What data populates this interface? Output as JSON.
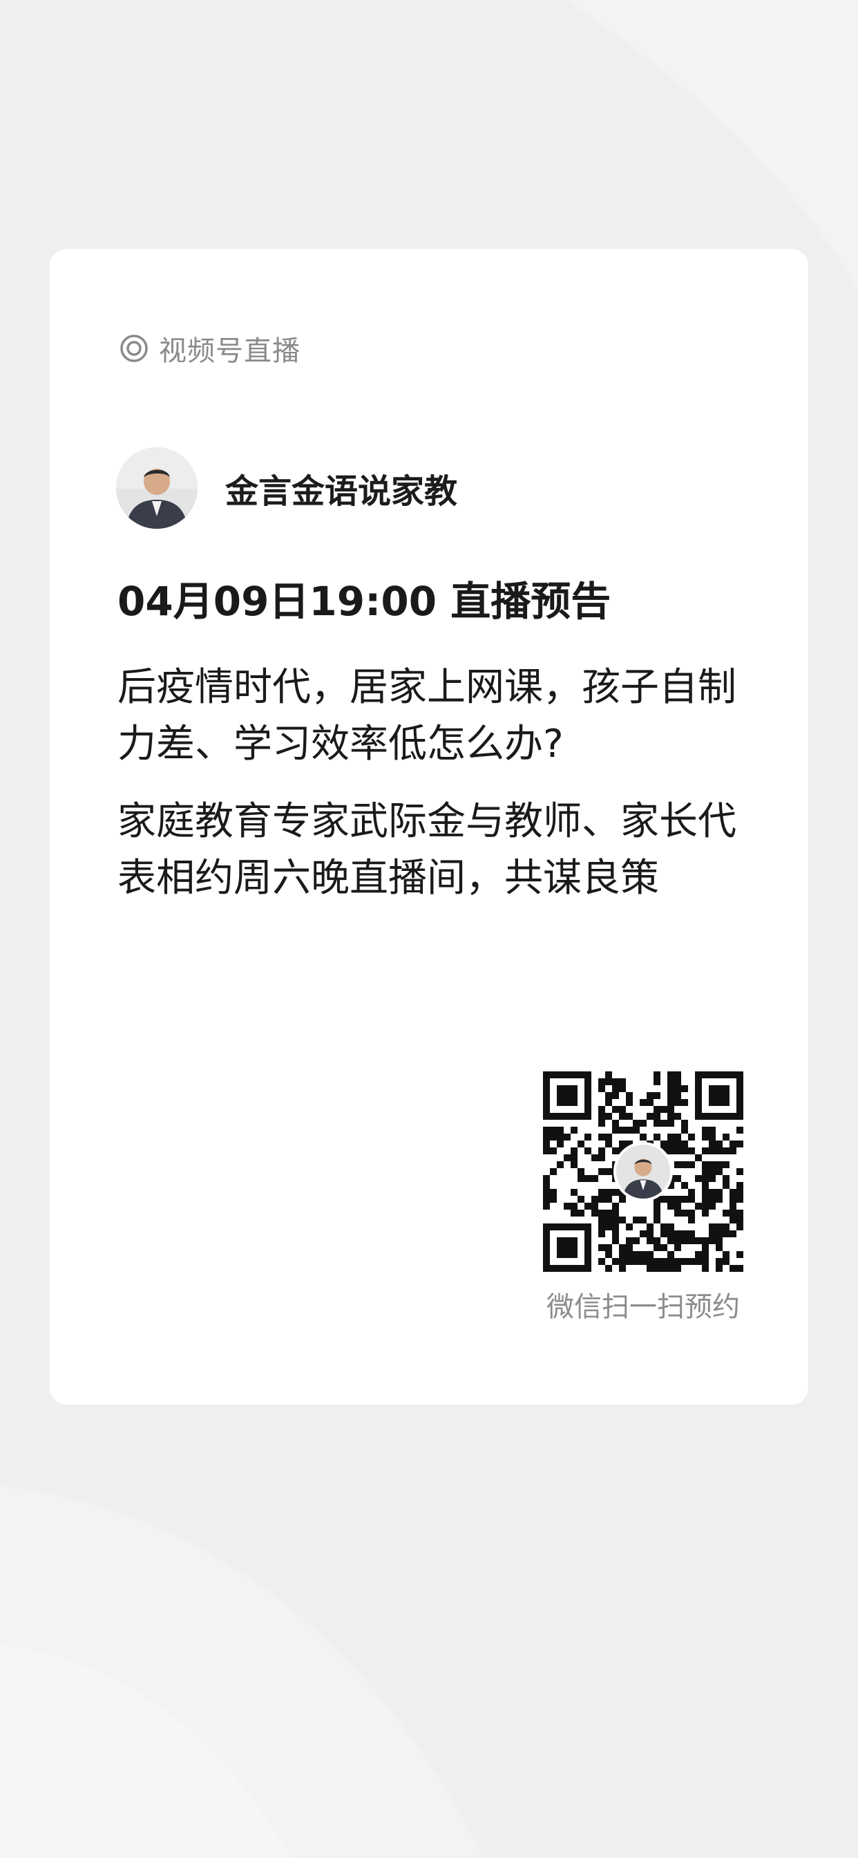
{
  "colors": {
    "page_background": "#efefef",
    "card_background": "#ffffff",
    "primary_text": "#1a1a1a",
    "secondary_text": "#8a8a8a"
  },
  "tag": {
    "icon": "live-broadcast-icon",
    "label": "视频号直播"
  },
  "author": {
    "avatar": "person-avatar",
    "name": "金言金语说家教"
  },
  "broadcast": {
    "title": "04月09日19:00 直播预告",
    "description_1": "后疫情时代，居家上网课，孩子自制力差、学习效率低怎么办?",
    "description_2": "家庭教育专家武际金与教师、家长代表相约周六晚直播间，共谋良策"
  },
  "qr": {
    "icon": "qr-code",
    "caption": "微信扫一扫预约"
  }
}
